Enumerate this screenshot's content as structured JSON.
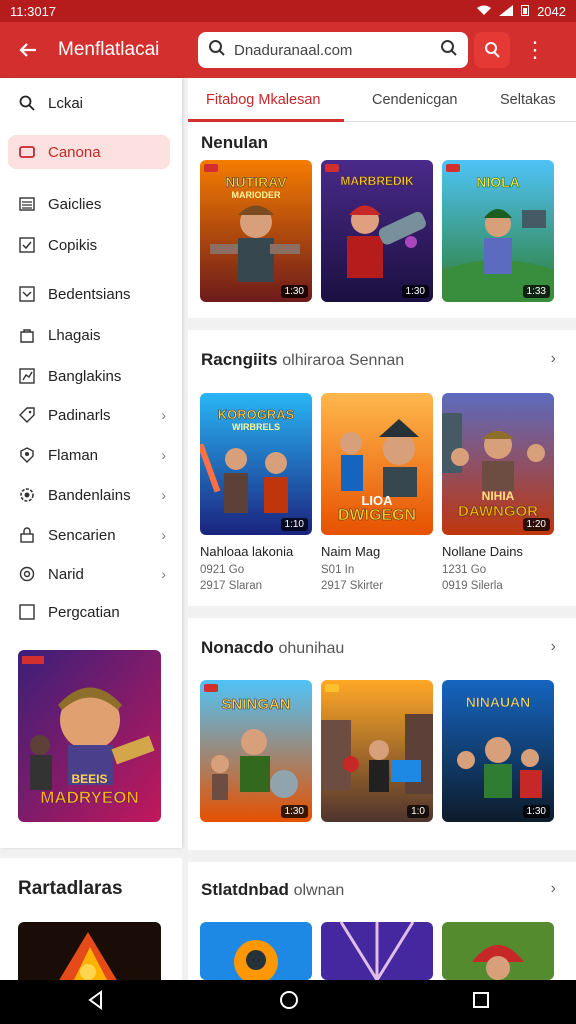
{
  "status": {
    "time": "11:3017",
    "right": "2042"
  },
  "appbar": {
    "title": "Menflatlacai",
    "search_value": "Dnaduranaal.com"
  },
  "sidebar": {
    "items": [
      {
        "label": "Lckai",
        "icon": "search-icon"
      },
      {
        "label": "Canona",
        "icon": "tag-icon",
        "active": true
      },
      {
        "label": "Gaiclies",
        "icon": "list-icon"
      },
      {
        "label": "Copikis",
        "icon": "check-icon"
      },
      {
        "label": "Bedentsians",
        "icon": "checkbox-icon"
      },
      {
        "label": "Lhagais",
        "icon": "bag-icon"
      },
      {
        "label": "Banglakins",
        "icon": "chart-icon"
      },
      {
        "label": "Padinarls",
        "icon": "tag-outline-icon",
        "chevron": true
      },
      {
        "label": "Flaman",
        "icon": "badge-icon",
        "chevron": true
      },
      {
        "label": "Bandenlains",
        "icon": "gear-icon",
        "chevron": true
      },
      {
        "label": "Sencarien",
        "icon": "lock-icon",
        "chevron": true
      },
      {
        "label": "Narid",
        "icon": "circle-icon",
        "chevron": true
      },
      {
        "label": "Pergcatian",
        "icon": "square-icon"
      }
    ],
    "promo_title_line1": "BEEIS",
    "promo_title_line2": "MADRYEON",
    "section2_title": "Rartadlaras"
  },
  "tabs": [
    {
      "label": "Fitabog Mkalesan",
      "active": true
    },
    {
      "label": "Cendenicgan"
    },
    {
      "label": "Seltakas"
    }
  ],
  "sections": [
    {
      "title": "Nenulan",
      "subtitle": "",
      "cards": [
        {
          "art": "NUTIRAV",
          "art2": "MARIODER",
          "badge": "1:30"
        },
        {
          "art": "MARBREDIK",
          "art2": "",
          "badge": "1:30"
        },
        {
          "art": "NIOLA",
          "art2": "",
          "badge": "1:33"
        }
      ]
    },
    {
      "title": "Racngiits",
      "subtitle": "olhiraroa Sennan",
      "cards": [
        {
          "art": "KOROGRAS",
          "art2": "WIRBRELS",
          "badge": "1:10",
          "name": "Nahloaa lakonia",
          "meta1": "0921 Go",
          "meta2": "2917 Slaran"
        },
        {
          "art": "LIOA",
          "art2": "DWIGEGN",
          "badge": "",
          "name": "Naim Mag",
          "meta1": "S01 In",
          "meta2": "2917 Skirter"
        },
        {
          "art": "NIHIA",
          "art2": "DAWNGOR",
          "badge": "1:20",
          "name": "Nollane Dains",
          "meta1": "1231 Go",
          "meta2": "0919 Silerla"
        }
      ]
    },
    {
      "title": "Nonacdo",
      "subtitle": "ohunihau",
      "cards": [
        {
          "art": "SNINGAN",
          "art2": "",
          "badge": "1:30"
        },
        {
          "art": "",
          "art2": "",
          "badge": "1:0"
        },
        {
          "art": "NINAUAN",
          "art2": "",
          "badge": "1:30"
        }
      ]
    },
    {
      "title": "Stlatdnbad",
      "subtitle": "olwnan",
      "cards": []
    }
  ],
  "colors": {
    "primary": "#d32f2f",
    "primary_dark": "#b71c1c",
    "active_bg": "#fde0e0"
  }
}
